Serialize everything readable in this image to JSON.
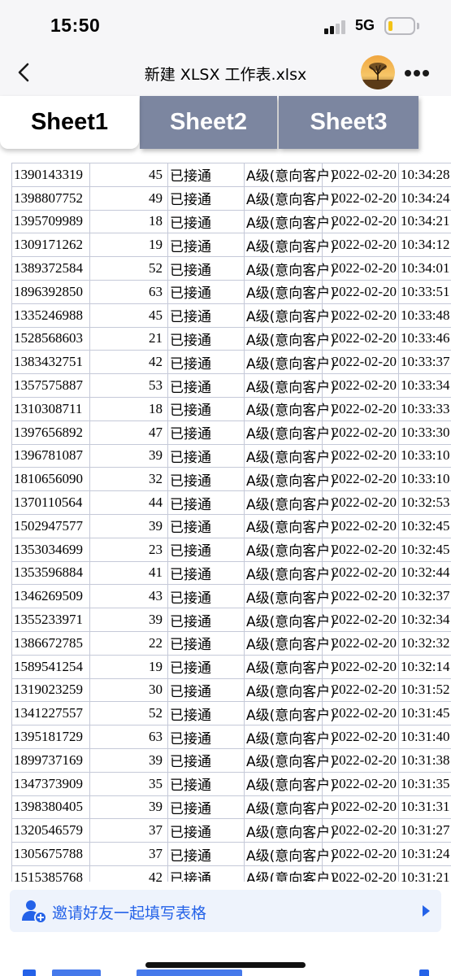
{
  "status_bar": {
    "time": "15:50",
    "network": "5G",
    "signal_bars_active": 2,
    "battery_level": 0.15,
    "battery_color": "#f3c317"
  },
  "nav": {
    "back_icon": "chevron-left-icon",
    "title": "新建 XLSX 工作表.xlsx",
    "avatar": "avatar-tree-sunset",
    "more_icon": "more-dots-icon"
  },
  "tabs": [
    {
      "label": "Sheet1",
      "active": true
    },
    {
      "label": "Sheet2",
      "active": false
    },
    {
      "label": "Sheet3",
      "active": false
    }
  ],
  "colors": {
    "tab_inactive": "#7c86a0",
    "grid_line": "#c5c9d8",
    "accent_blue": "#2462e8",
    "banner_bg": "#eef3fc"
  },
  "table": {
    "rows": [
      [
        "1390143319",
        "45",
        "已接通",
        "A级(意向客户)",
        "2022-02-20",
        "10:34:28"
      ],
      [
        "1398807752",
        "49",
        "已接通",
        "A级(意向客户)",
        "2022-02-20",
        "10:34:24"
      ],
      [
        "1395709989",
        "18",
        "已接通",
        "A级(意向客户)",
        "2022-02-20",
        "10:34:21"
      ],
      [
        "1309171262",
        "19",
        "已接通",
        "A级(意向客户)",
        "2022-02-20",
        "10:34:12"
      ],
      [
        "1389372584",
        "52",
        "已接通",
        "A级(意向客户)",
        "2022-02-20",
        "10:34:01"
      ],
      [
        "1896392850",
        "63",
        "已接通",
        "A级(意向客户)",
        "2022-02-20",
        "10:33:51"
      ],
      [
        "1335246988",
        "45",
        "已接通",
        "A级(意向客户)",
        "2022-02-20",
        "10:33:48"
      ],
      [
        "1528568603",
        "21",
        "已接通",
        "A级(意向客户)",
        "2022-02-20",
        "10:33:46"
      ],
      [
        "1383432751",
        "42",
        "已接通",
        "A级(意向客户)",
        "2022-02-20",
        "10:33:37"
      ],
      [
        "1357575887",
        "53",
        "已接通",
        "A级(意向客户)",
        "2022-02-20",
        "10:33:34"
      ],
      [
        "1310308711",
        "18",
        "已接通",
        "A级(意向客户)",
        "2022-02-20",
        "10:33:33"
      ],
      [
        "1397656892",
        "47",
        "已接通",
        "A级(意向客户)",
        "2022-02-20",
        "10:33:30"
      ],
      [
        "1396781087",
        "39",
        "已接通",
        "A级(意向客户)",
        "2022-02-20",
        "10:33:10"
      ],
      [
        "1810656090",
        "32",
        "已接通",
        "A级(意向客户)",
        "2022-02-20",
        "10:33:10"
      ],
      [
        "1370110564",
        "44",
        "已接通",
        "A级(意向客户)",
        "2022-02-20",
        "10:32:53"
      ],
      [
        "1502947577",
        "39",
        "已接通",
        "A级(意向客户)",
        "2022-02-20",
        "10:32:45"
      ],
      [
        "1353034699",
        "23",
        "已接通",
        "A级(意向客户)",
        "2022-02-20",
        "10:32:45"
      ],
      [
        "1353596884",
        "41",
        "已接通",
        "A级(意向客户)",
        "2022-02-20",
        "10:32:44"
      ],
      [
        "1346269509",
        "43",
        "已接通",
        "A级(意向客户)",
        "2022-02-20",
        "10:32:37"
      ],
      [
        "1355233971",
        "39",
        "已接通",
        "A级(意向客户)",
        "2022-02-20",
        "10:32:34"
      ],
      [
        "1386672785",
        "22",
        "已接通",
        "A级(意向客户)",
        "2022-02-20",
        "10:32:32"
      ],
      [
        "1589541254",
        "19",
        "已接通",
        "A级(意向客户)",
        "2022-02-20",
        "10:32:14"
      ],
      [
        "1319023259",
        "30",
        "已接通",
        "A级(意向客户)",
        "2022-02-20",
        "10:31:52"
      ],
      [
        "1341227557",
        "52",
        "已接通",
        "A级(意向客户)",
        "2022-02-20",
        "10:31:45"
      ],
      [
        "1395181729",
        "63",
        "已接通",
        "A级(意向客户)",
        "2022-02-20",
        "10:31:40"
      ],
      [
        "1899737169",
        "39",
        "已接通",
        "A级(意向客户)",
        "2022-02-20",
        "10:31:38"
      ],
      [
        "1347373909",
        "35",
        "已接通",
        "A级(意向客户)",
        "2022-02-20",
        "10:31:35"
      ],
      [
        "1398380405",
        "39",
        "已接通",
        "A级(意向客户)",
        "2022-02-20",
        "10:31:31"
      ],
      [
        "1320546579",
        "37",
        "已接通",
        "A级(意向客户)",
        "2022-02-20",
        "10:31:27"
      ],
      [
        "1305675788",
        "37",
        "已接通",
        "A级(意向客户)",
        "2022-02-20",
        "10:31:24"
      ],
      [
        "1515385768",
        "42",
        "已接通",
        "A级(意向客户)",
        "2022-02-20",
        "10:31:21"
      ]
    ]
  },
  "invite": {
    "icon": "add-user-icon",
    "label": "邀请好友一起填写表格",
    "arrow_icon": "play-arrow-icon"
  }
}
